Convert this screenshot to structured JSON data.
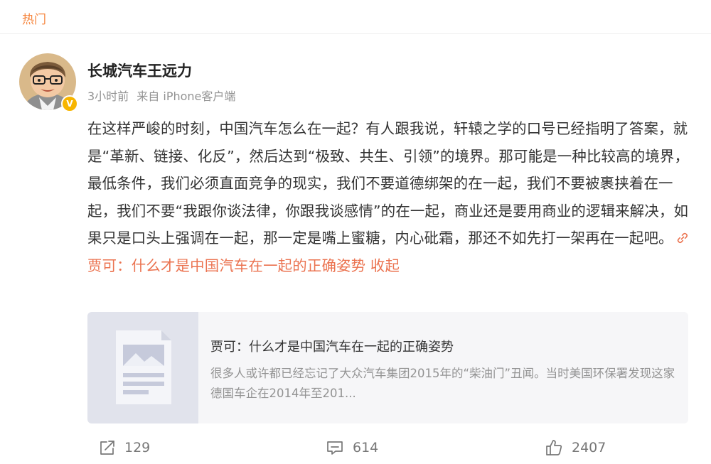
{
  "tabs": {
    "hot": "热门"
  },
  "post": {
    "author": "长城汽车王远力",
    "time": "3小时前",
    "source": "来自 iPhone客户端",
    "text": "在这样严峻的时刻，中国汽车怎么在一起？有人跟我说，轩辕之学的口号已经指明了答案，就是“革新、链接、化反”，然后达到“极致、共生、引领”的境界。那可能是一种比较高的境界，最低条件，我们必须直面竞争的现实，我们不要道德绑架的在一起，我们不要被裹挟着在一起，我们不要“我跟你谈法律，你跟我谈感情”的在一起，商业还是要用商业的逻辑来解决，如果只是口头上强调在一起，那一定是嘴上蜜糖，内心砒霜，那还不如先打一架再在一起吧。",
    "link_text": "贾可：什么才是中国汽车在一起的正确姿势",
    "collapse": "收起",
    "verified_badge": "V"
  },
  "card": {
    "title": "贾可：什么才是中国汽车在一起的正确姿势",
    "desc": "很多人或许都已经忘记了大众汽车集团2015年的“柴油门”丑闻。当时美国环保署发现这家德国车企在2014年至201..."
  },
  "actions": {
    "forward_count": "129",
    "comment_count": "614",
    "like_count": "2407"
  },
  "icons": {
    "forward": "forward-icon",
    "comment": "comment-icon",
    "like": "like-icon",
    "link": "link-icon"
  },
  "colors": {
    "accent": "#eb7350",
    "hot_tab": "#f6863e",
    "muted": "#939393",
    "verified": "#f7b500"
  }
}
